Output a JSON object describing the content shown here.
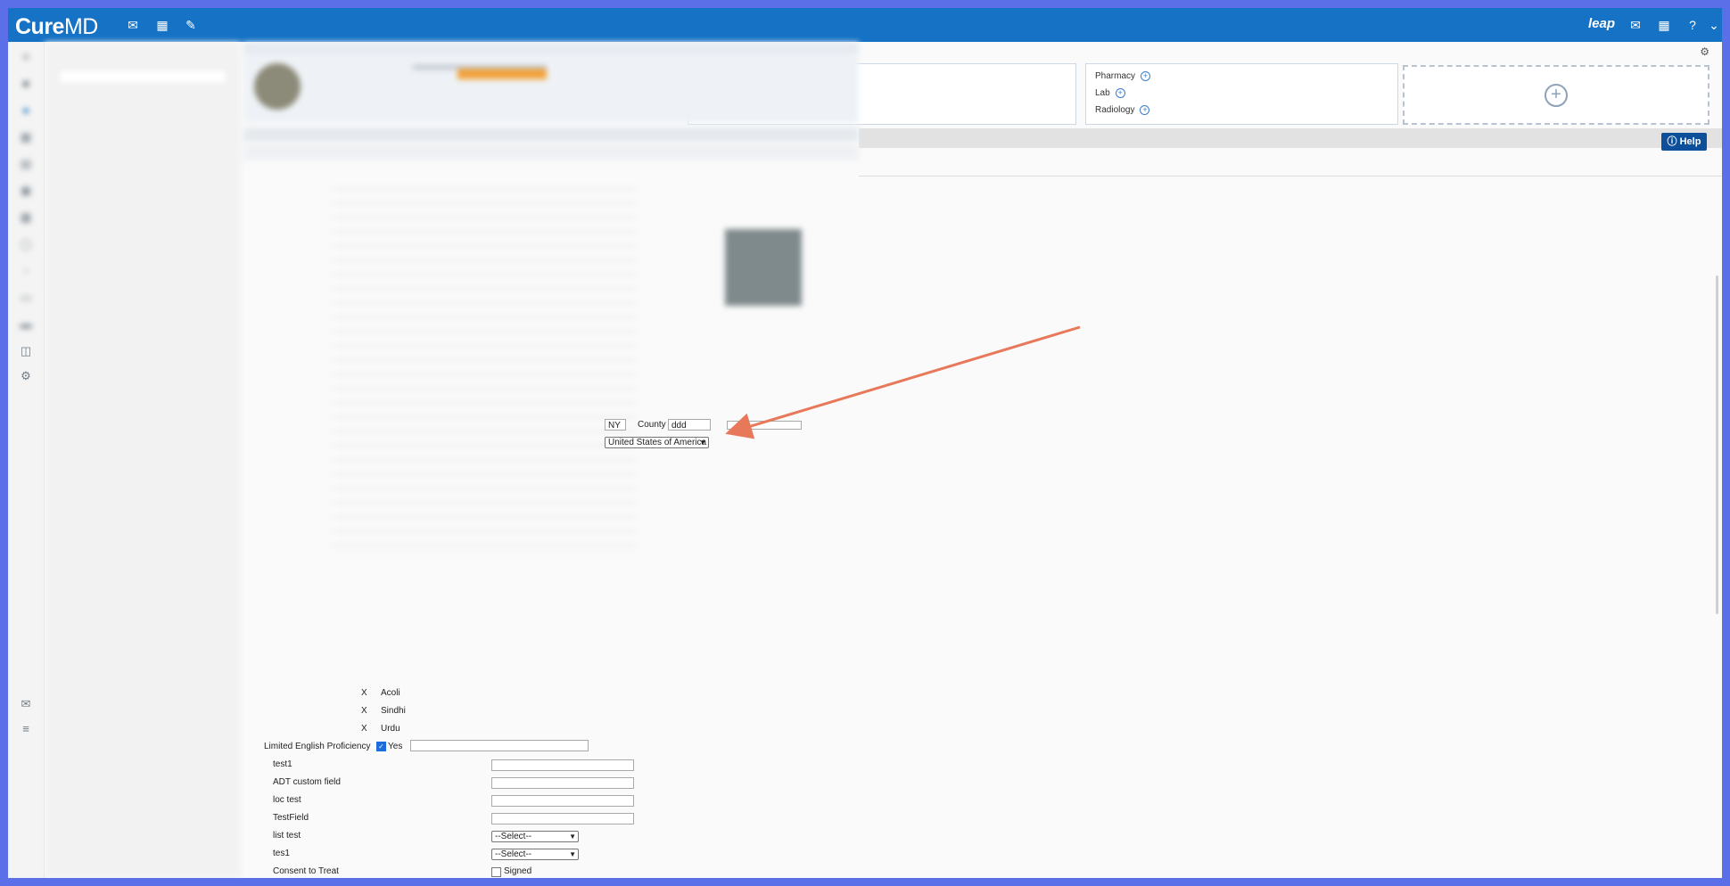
{
  "app": {
    "logo_main": "Cure",
    "logo_suffix": "MD",
    "leap_label": "leap",
    "help_label": "Help"
  },
  "orders_panel": {
    "pharmacy": "Pharmacy",
    "lab": "Lab",
    "radiology": "Radiology"
  },
  "address": {
    "state_value": "NY",
    "county_label": "County",
    "county_value": "ddd",
    "country_value": "United States of America"
  },
  "languages": [
    {
      "mark": "X",
      "name": "Acoli"
    },
    {
      "mark": "X",
      "name": "Sindhi"
    },
    {
      "mark": "X",
      "name": "Urdu"
    }
  ],
  "limited_english": {
    "label": "Limited English Proficiency",
    "yes_label": "Yes"
  },
  "custom_fields": [
    {
      "label": "test1"
    },
    {
      "label": "ADT custom field"
    },
    {
      "label": "loc test"
    },
    {
      "label": "TestField"
    }
  ],
  "select_fields": [
    {
      "label": "list test",
      "value": "--Select--"
    },
    {
      "label": "tes1",
      "value": "--Select--"
    }
  ],
  "consent": {
    "label": "Consent to Treat",
    "signed_label": "Signed"
  },
  "colors": {
    "topbar": "#1572c4",
    "help_button": "#0d4f9a",
    "arrow": "#e8785a"
  }
}
